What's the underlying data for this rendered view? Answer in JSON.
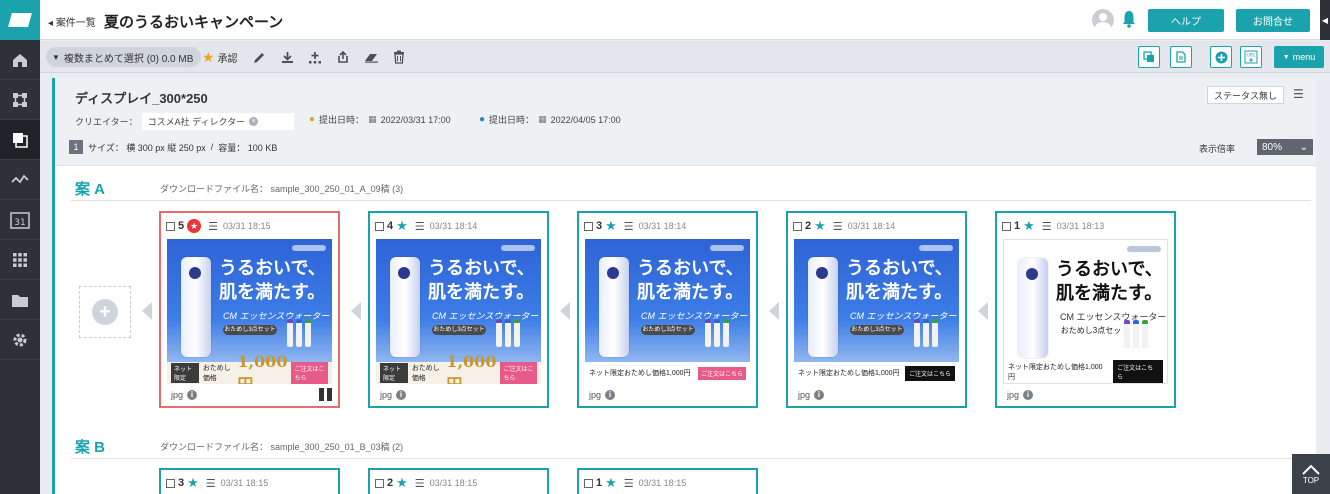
{
  "header": {
    "breadcrumb": "案件一覧",
    "title": "夏のうるおいキャンペーン",
    "help_label": "ヘルプ",
    "contact_label": "お問合せ"
  },
  "toolbar": {
    "bulk_select_label": "複数まとめて選択 (0) 0.0 MB",
    "approve_label": "承認",
    "menu_label": "menu"
  },
  "panel": {
    "title": "ディスプレイ_300*250",
    "status_button": "ステータス無し",
    "creator_label": "クリエイター：",
    "creator_value": "コスメA社 ディレクター",
    "submitted_label": "提出日時：",
    "submitted_value": "2022/03/31 17:00",
    "due_label": "提出日時：",
    "due_value": "2022/04/05 17:00",
    "size_num": "1",
    "size_text": "サイズ： 横 300 px  縦 250 px",
    "capacity_text": "容量： 100 KB",
    "zoom_label": "表示倍率",
    "zoom_value": "80%"
  },
  "sections": [
    {
      "heading": "案 A",
      "download_label": "ダウンロードファイル名：",
      "download_name": "sample_300_250_01_A_09稿 (3)",
      "cards": [
        {
          "num": "5",
          "time": "03/31 18:15",
          "format": "jpg",
          "selected": true,
          "style": "blue-gold"
        },
        {
          "num": "4",
          "time": "03/31 18:14",
          "format": "jpg",
          "selected": false,
          "style": "blue-gold"
        },
        {
          "num": "3",
          "time": "03/31 18:14",
          "format": "jpg",
          "selected": false,
          "style": "blue"
        },
        {
          "num": "2",
          "time": "03/31 18:14",
          "format": "jpg",
          "selected": false,
          "style": "blue-black"
        },
        {
          "num": "1",
          "time": "03/31 18:13",
          "format": "jpg",
          "selected": false,
          "style": "white"
        }
      ]
    },
    {
      "heading": "案 B",
      "download_label": "ダウンロードファイル名：",
      "download_name": "sample_300_250_01_B_03稿 (2)",
      "cards": [
        {
          "num": "3",
          "time": "03/31 18:15"
        },
        {
          "num": "2",
          "time": "03/31 18:15"
        },
        {
          "num": "1",
          "time": "03/31 18:15"
        }
      ]
    }
  ],
  "banner": {
    "headline1": "うるおいで、",
    "headline2": "肌を満たす。",
    "sub_italic": "CM エッセンスウォーター",
    "set_label": "おためし3点セット",
    "net_tag": "ネット限定",
    "trial_price_label": "おためし価格",
    "big_price": "1,000円",
    "cta": "ご注文はこちら",
    "net_price_line": "ネット限定おためし価格1,000円"
  },
  "top_label": "TOP",
  "colors": {
    "accent": "#1ba3ad",
    "selected": "#e86a6a",
    "rail": "#2e3238"
  }
}
